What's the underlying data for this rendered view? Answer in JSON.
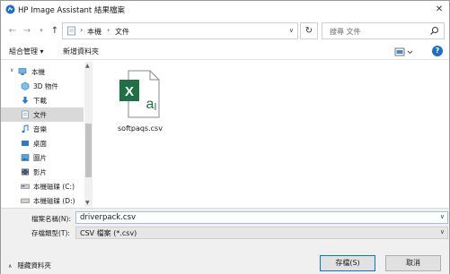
{
  "window": {
    "title": "HP Image Assistant 結果檔案"
  },
  "address": {
    "breadcrumbs": [
      "本機",
      "文件"
    ],
    "search_placeholder": "搜尋 文件"
  },
  "toolbar": {
    "organize_label": "組合管理 ▾",
    "new_folder_label": "新增資料夾",
    "help_label": "?"
  },
  "sidebar": {
    "items": [
      {
        "label": "本機",
        "icon": "computer-icon"
      },
      {
        "label": "3D 物件",
        "icon": "3d-objects-icon"
      },
      {
        "label": "下載",
        "icon": "download-icon"
      },
      {
        "label": "文件",
        "icon": "documents-icon",
        "selected": true
      },
      {
        "label": "音樂",
        "icon": "music-icon"
      },
      {
        "label": "桌面",
        "icon": "desktop-icon"
      },
      {
        "label": "圖片",
        "icon": "pictures-icon"
      },
      {
        "label": "影片",
        "icon": "videos-icon"
      },
      {
        "label": "本機磁碟 (C:)",
        "icon": "drive-icon"
      },
      {
        "label": "本機磁碟 (D:)",
        "icon": "drive-icon"
      }
    ]
  },
  "files": [
    {
      "name": "softpaqs.csv",
      "icon": "excel-csv-icon"
    }
  ],
  "form": {
    "filename_label": "檔案名稱(N):",
    "filename_value": "driverpack.csv",
    "filetype_label": "存檔類型(T):",
    "filetype_value": "CSV 檔案 (*.csv)"
  },
  "footer": {
    "hide_folders_label": "隱藏資料夾",
    "save_label": "存檔(S)",
    "cancel_label": "取消"
  },
  "colors": {
    "accent": "#0078d7",
    "excel_green": "#1e7145",
    "selected_bg": "#d9d9d9"
  }
}
